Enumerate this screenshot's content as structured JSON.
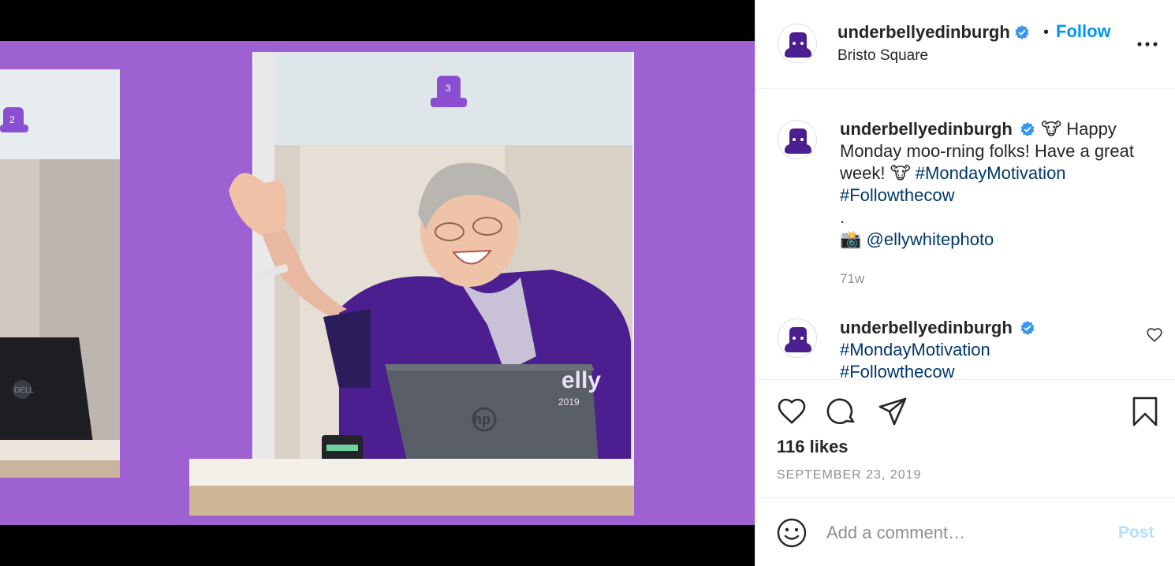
{
  "post": {
    "username": "underbellyedinburgh",
    "verified": true,
    "follow_label": "Follow",
    "separator": "•",
    "location": "Bristo Square",
    "more_icon": "more-options-icon"
  },
  "caption": {
    "username": "underbellyedinburgh",
    "emoji_cow": "🐮",
    "text_1": " Happy Monday moo-rning folks! Have a great week! ",
    "hashtag_1": "#MondayMotivation",
    "hashtag_2": "#Followthecow",
    "dot_line": ".",
    "camera_emoji": "📸",
    "mention": "@ellywhitephoto",
    "time": "71w"
  },
  "comment": {
    "username": "underbellyedinburgh",
    "hashtag_1": "#MondayMotivation",
    "hashtag_2": "#Followthecow"
  },
  "stats": {
    "likes": "116 likes",
    "date": "SEPTEMBER 23, 2019"
  },
  "composer": {
    "placeholder": "Add a comment…",
    "post_label": "Post"
  },
  "photo": {
    "laptop_brand": "hp",
    "laptop_brand_left": "DELL",
    "booth_number_1": "2",
    "booth_number_2": "3",
    "shirt_text": "elly",
    "shirt_year": "2019"
  },
  "colors": {
    "brand_purple": "#4b1f8f",
    "wall_purple": "#9a5fd0",
    "link_blue": "#0095f6",
    "hashtag_navy": "#00376b",
    "verified_blue": "#3897f0"
  }
}
